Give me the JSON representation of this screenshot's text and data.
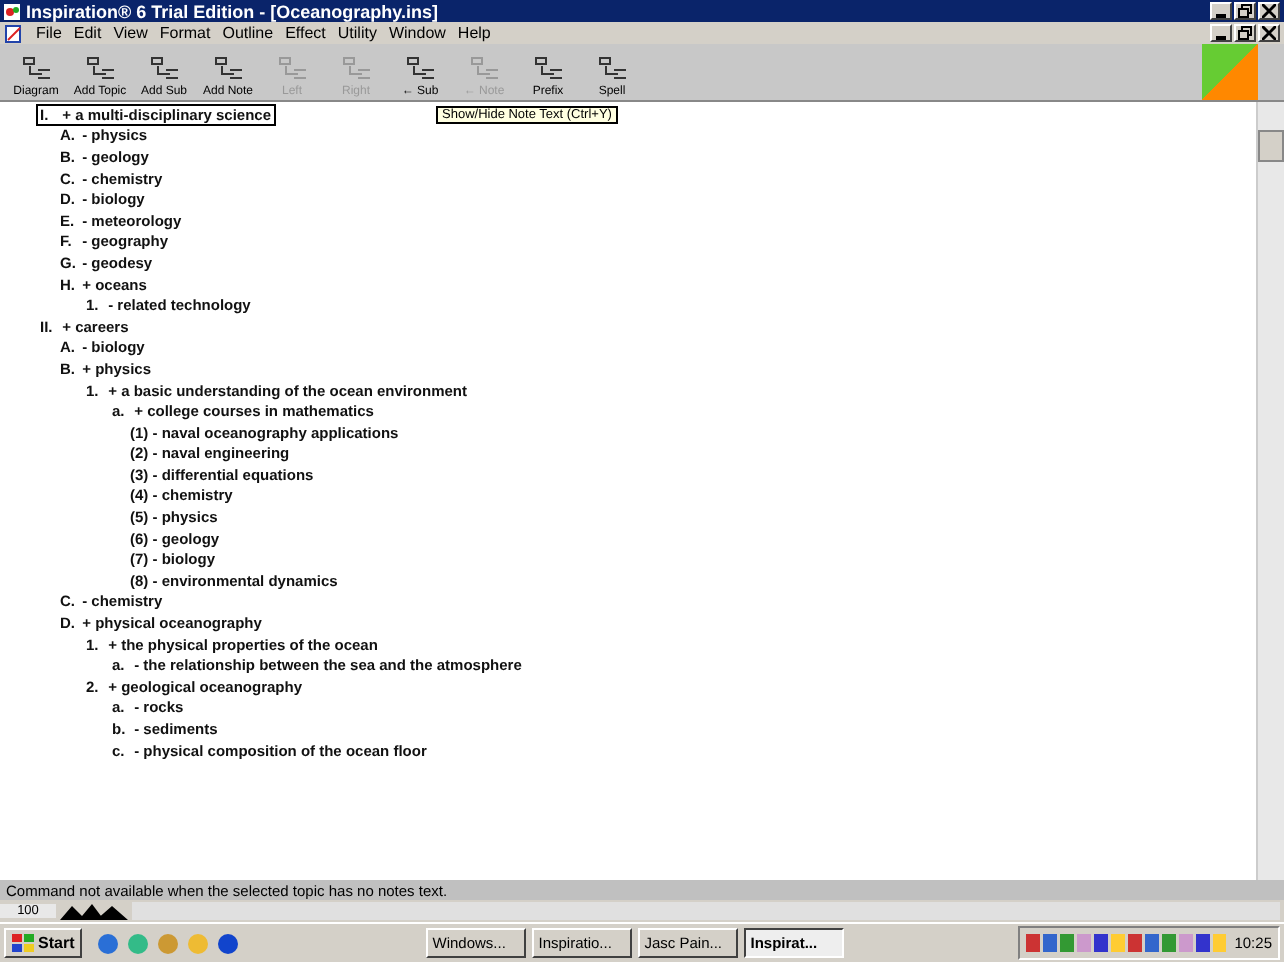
{
  "window": {
    "title": "Inspiration® 6 Trial Edition - [Oceanography.ins]"
  },
  "menu": [
    "File",
    "Edit",
    "View",
    "Format",
    "Outline",
    "Effect",
    "Utility",
    "Window",
    "Help"
  ],
  "toolbar": [
    {
      "label": "Diagram",
      "disabled": false
    },
    {
      "label": "Add Topic",
      "disabled": false
    },
    {
      "label": "Add Sub",
      "disabled": false
    },
    {
      "label": "Add Note",
      "disabled": false
    },
    {
      "label": "Left",
      "disabled": true
    },
    {
      "label": "Right",
      "disabled": true
    },
    {
      "label": "← Sub",
      "disabled": false
    },
    {
      "label": "← Note",
      "disabled": true
    },
    {
      "label": "Prefix",
      "disabled": false
    },
    {
      "label": "Spell",
      "disabled": false
    }
  ],
  "tooltip": "Show/Hide Note Text (Ctrl+Y)",
  "outline": [
    {
      "prefix": "I.",
      "marker": "+",
      "text": "a multi-disciplinary science",
      "selected": true,
      "children": [
        {
          "prefix": "A.",
          "marker": "-",
          "text": "physics",
          "selected": false
        },
        {
          "prefix": "B.",
          "marker": "-",
          "text": "geology",
          "selected": false
        },
        {
          "prefix": "C.",
          "marker": "-",
          "text": "chemistry",
          "selected": false
        },
        {
          "prefix": "D.",
          "marker": "-",
          "text": "biology",
          "selected": false
        },
        {
          "prefix": "E.",
          "marker": "-",
          "text": "meteorology",
          "selected": false
        },
        {
          "prefix": "F.",
          "marker": "-",
          "text": "geography",
          "selected": false
        },
        {
          "prefix": "G.",
          "marker": "-",
          "text": "geodesy",
          "selected": false
        },
        {
          "prefix": "H.",
          "marker": "+",
          "text": "oceans",
          "selected": false,
          "children": [
            {
              "prefix": "1.",
              "marker": "-",
              "text": "related technology",
              "selected": false
            }
          ]
        }
      ]
    },
    {
      "prefix": "II.",
      "marker": "+",
      "text": "careers",
      "selected": false,
      "children": [
        {
          "prefix": "A.",
          "marker": "-",
          "text": "biology",
          "selected": false
        },
        {
          "prefix": "B.",
          "marker": "+",
          "text": "physics",
          "selected": false,
          "children": [
            {
              "prefix": "1.",
              "marker": "+",
              "text": "a basic understanding of the ocean environment",
              "selected": false,
              "children": [
                {
                  "prefix": "a.",
                  "marker": "+",
                  "text": "college courses in mathematics",
                  "selected": false,
                  "children": [
                    {
                      "prefix": "(1)",
                      "marker": "-",
                      "text": "naval oceanography applications",
                      "selected": false
                    },
                    {
                      "prefix": "(2)",
                      "marker": "-",
                      "text": "naval engineering",
                      "selected": false
                    },
                    {
                      "prefix": "(3)",
                      "marker": "-",
                      "text": "differential equations",
                      "selected": false
                    },
                    {
                      "prefix": "(4)",
                      "marker": "-",
                      "text": "chemistry",
                      "selected": false
                    },
                    {
                      "prefix": "(5)",
                      "marker": "-",
                      "text": "physics",
                      "selected": false
                    },
                    {
                      "prefix": "(6)",
                      "marker": "-",
                      "text": "geology",
                      "selected": false
                    },
                    {
                      "prefix": "(7)",
                      "marker": "-",
                      "text": "biology",
                      "selected": false
                    },
                    {
                      "prefix": "(8)",
                      "marker": "-",
                      "text": "environmental dynamics",
                      "selected": false
                    }
                  ]
                }
              ]
            }
          ]
        },
        {
          "prefix": "C.",
          "marker": "-",
          "text": "chemistry",
          "selected": false
        },
        {
          "prefix": "D.",
          "marker": "+",
          "text": "physical oceanography",
          "selected": false,
          "children": [
            {
              "prefix": "1.",
              "marker": "+",
              "text": "the physical properties of the ocean",
              "selected": false,
              "children": [
                {
                  "prefix": "a.",
                  "marker": "-",
                  "text": "the relationship between the sea and the atmosphere",
                  "selected": false
                }
              ]
            },
            {
              "prefix": "2.",
              "marker": "+",
              "text": "geological oceanography",
              "selected": false,
              "children": [
                {
                  "prefix": "a.",
                  "marker": "-",
                  "text": "rocks",
                  "selected": false
                },
                {
                  "prefix": "b.",
                  "marker": "-",
                  "text": "sediments",
                  "selected": false
                },
                {
                  "prefix": "c.",
                  "marker": "-",
                  "text": "physical composition of the ocean floor",
                  "selected": false
                }
              ]
            }
          ]
        }
      ]
    }
  ],
  "status_bar": "Command not available when the selected topic has no notes text.",
  "zoom": "100",
  "taskbar": {
    "start": "Start",
    "tasks": [
      {
        "label": "Windows...",
        "selected": false
      },
      {
        "label": "Inspiratio...",
        "selected": false
      },
      {
        "label": "Jasc Pain...",
        "selected": false
      },
      {
        "label": "Inspirat...",
        "selected": true
      }
    ],
    "clock": "10:25"
  }
}
